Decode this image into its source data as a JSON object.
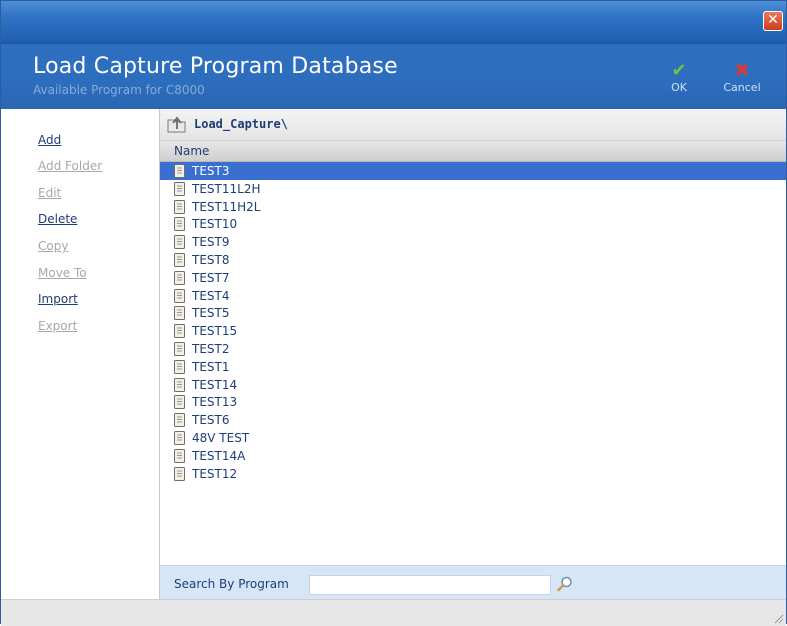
{
  "window": {
    "close_glyph": "✕"
  },
  "header": {
    "title": "Load Capture Program Database",
    "subtitle": "Available Program for C8000",
    "ok": {
      "icon": "checkmark-icon",
      "glyph": "✔",
      "label": "OK"
    },
    "cancel": {
      "icon": "x-cross-icon",
      "glyph": "✖",
      "label": "Cancel"
    }
  },
  "sidebar": {
    "items": [
      {
        "label": "Add",
        "enabled": true
      },
      {
        "label": "Add Folder",
        "enabled": false
      },
      {
        "label": "Edit",
        "enabled": false
      },
      {
        "label": "Delete",
        "enabled": true
      },
      {
        "label": "Copy",
        "enabled": false
      },
      {
        "label": "Move To",
        "enabled": false
      },
      {
        "label": "Import",
        "enabled": true
      },
      {
        "label": "Export",
        "enabled": false
      }
    ]
  },
  "path": {
    "icon": "folder-up-icon",
    "text": "Load_Capture\\"
  },
  "table": {
    "column": "Name",
    "selected_index": 0,
    "rows": [
      "TEST3",
      "TEST11L2H",
      "TEST11H2L",
      "TEST10",
      "TEST9",
      "TEST8",
      "TEST7",
      "TEST4",
      "TEST5",
      "TEST15",
      "TEST2",
      "TEST1",
      "TEST14",
      "TEST13",
      "TEST6",
      "48V TEST",
      "TEST14A",
      "TEST12"
    ]
  },
  "search": {
    "label": "Search By Program",
    "value": "",
    "icon": "magnifier-icon"
  },
  "colors": {
    "accent": "#2d6dbd",
    "selection": "#3a6fd0",
    "link": "#1e3d78",
    "disabled": "#a8a8a8"
  }
}
